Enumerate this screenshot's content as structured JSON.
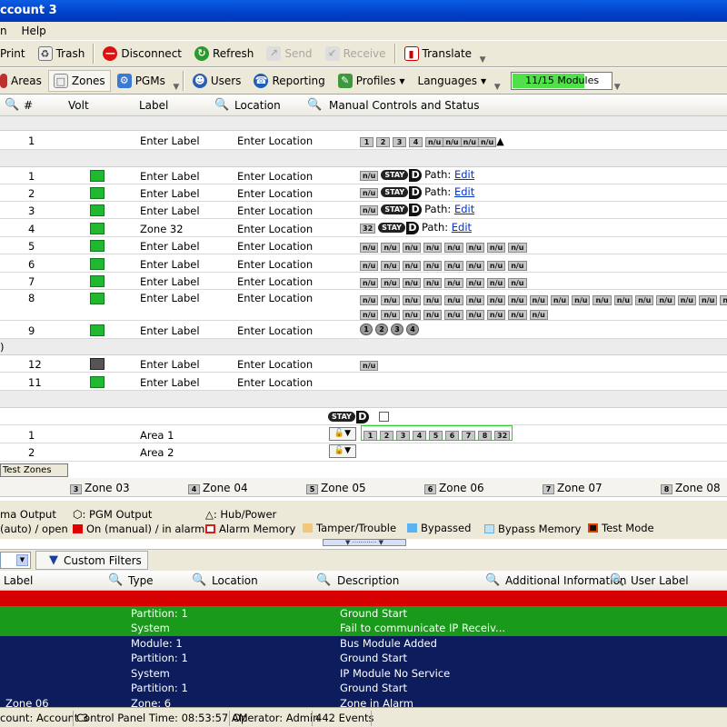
{
  "window": {
    "title": "ccount 3"
  },
  "menu": [
    "n",
    "Help"
  ],
  "toolbar1": {
    "print": "Print",
    "trash": "Trash",
    "disconnect": "Disconnect",
    "refresh": "Refresh",
    "send": "Send",
    "receive": "Receive",
    "translate": "Translate"
  },
  "toolbar2": {
    "areas": "Areas",
    "zones": "Zones",
    "pgms": "PGMs",
    "users": "Users",
    "reporting": "Reporting",
    "profiles": "Profiles",
    "languages": "Languages",
    "modules": "11/15 Modules",
    "modules_fraction": 0.733
  },
  "grid_headers": {
    "num": "#",
    "volt": "Volt",
    "label": "Label",
    "location": "Location",
    "controls": "Manual Controls and Status"
  },
  "rows": {
    "pgm1": {
      "num": "1",
      "label": "Enter Label",
      "location": "Enter Location",
      "chips": [
        "1",
        "2",
        "3",
        "4",
        "n/u",
        "n/u",
        "n/u",
        "n/u"
      ]
    },
    "z1": {
      "num": "1",
      "label": "Enter Label",
      "location": "Enter Location",
      "chip": "n/u",
      "stay": "STAY",
      "d": "D",
      "path": "Path:",
      "edit": "Edit"
    },
    "z2": {
      "num": "2",
      "label": "Enter Label",
      "location": "Enter Location",
      "chip": "n/u",
      "stay": "STAY",
      "d": "D",
      "path": "Path:",
      "edit": "Edit"
    },
    "z3": {
      "num": "3",
      "label": "Enter Label",
      "location": "Enter Location",
      "chip": "n/u",
      "stay": "STAY",
      "d": "D",
      "path": "Path:",
      "edit": "Edit"
    },
    "z4": {
      "num": "4",
      "label": "Zone 32",
      "location": "Enter Location",
      "chip": "32",
      "stay": "STAY",
      "d": "D",
      "path": "Path:",
      "edit": "Edit"
    },
    "z5": {
      "num": "5",
      "label": "Enter Label",
      "location": "Enter Location",
      "chips": [
        "n/u",
        "n/u",
        "n/u",
        "n/u",
        "n/u",
        "n/u",
        "n/u",
        "n/u"
      ]
    },
    "z6": {
      "num": "6",
      "label": "Enter Label",
      "location": "Enter Location",
      "chips": [
        "n/u",
        "n/u",
        "n/u",
        "n/u",
        "n/u",
        "n/u",
        "n/u",
        "n/u"
      ]
    },
    "z7": {
      "num": "7",
      "label": "Enter Label",
      "location": "Enter Location",
      "chips": [
        "n/u",
        "n/u",
        "n/u",
        "n/u",
        "n/u",
        "n/u",
        "n/u",
        "n/u"
      ]
    },
    "z8": {
      "num": "8",
      "label": "Enter Label",
      "location": "Enter Location",
      "chips1": [
        "n/u",
        "n/u",
        "n/u",
        "n/u",
        "n/u",
        "n/u",
        "n/u",
        "n/u",
        "n/u",
        "n/u",
        "n/u",
        "n/u",
        "n/u",
        "n/u",
        "n/u",
        "n/u",
        "n/u",
        "n/u",
        "n/u"
      ],
      "chips2": [
        "n/u",
        "n/u",
        "n/u",
        "n/u",
        "n/u",
        "n/u",
        "n/u",
        "n/u",
        "n/u"
      ]
    },
    "z9": {
      "num": "9",
      "label": "Enter Label",
      "location": "Enter Location",
      "rounds": [
        "1",
        "2",
        "3",
        "4"
      ]
    },
    "m12": {
      "num": "12",
      "label": "Enter Label",
      "location": "Enter Location",
      "chip": "n/u"
    },
    "m11": {
      "num": "11",
      "label": "Enter Label",
      "location": "Enter Location"
    },
    "areas_hdr": {
      "stay": "STAY",
      "d": "D"
    },
    "a1": {
      "num": "1",
      "label": "Area 1",
      "chips": [
        "1",
        "2",
        "3",
        "4",
        "5",
        "6",
        "7",
        "8",
        "32"
      ]
    },
    "a2": {
      "num": "2",
      "label": "Area 2"
    }
  },
  "group_glyph": ")",
  "test_zones": "Test Zones",
  "zone_bar": [
    {
      "n": "3",
      "label": "Zone 03"
    },
    {
      "n": "4",
      "label": "Zone 04"
    },
    {
      "n": "5",
      "label": "Zone 05"
    },
    {
      "n": "6",
      "label": "Zone 06"
    },
    {
      "n": "7",
      "label": "Zone 07"
    },
    {
      "n": "8",
      "label": "Zone 08"
    }
  ],
  "legend": {
    "ma_output": "ma Output",
    "pgm_output": ": PGM Output",
    "hub_power": ": Hub/Power",
    "auto_open": "(auto) / open",
    "on_manual": "On (manual) / in alarm",
    "alarm_memory": "Alarm Memory",
    "tamper": "Tamper/Trouble",
    "bypassed": "Bypassed",
    "bypass_memory": "Bypass Memory",
    "test_mode": "Test Mode"
  },
  "filter": {
    "custom": "Custom Filters"
  },
  "event_headers": {
    "label": "Label",
    "type": "Type",
    "location": "Location",
    "description": "Description",
    "additional": "Additional Information",
    "user_label": "User Label"
  },
  "events": [
    {
      "type": "",
      "description": "",
      "bg": "#d60000"
    },
    {
      "type": "Partition: 1",
      "description": "Ground Start",
      "bg": "#1a9a1a"
    },
    {
      "type": "System",
      "description": "Fail to communicate IP Receiv...",
      "bg": "#1a9a1a"
    },
    {
      "type": "Module: 1",
      "description": "Bus Module Added",
      "bg": "#0c1c5c"
    },
    {
      "type": "Partition: 1",
      "description": "Ground Start",
      "bg": "#0c1c5c"
    },
    {
      "type": "System",
      "description": "IP Module No Service",
      "bg": "#0c1c5c"
    },
    {
      "type": "Partition: 1",
      "description": "Ground Start",
      "bg": "#0c1c5c"
    },
    {
      "label": "Zone 06",
      "type": "Zone: 6",
      "description": "Zone in Alarm",
      "bg": "#0c1c5c"
    }
  ],
  "status": {
    "account": "count: Account 3",
    "time": "Control Panel Time: 08:53:57 AM",
    "operator": "Operator: Admin",
    "events": "442 Events"
  }
}
